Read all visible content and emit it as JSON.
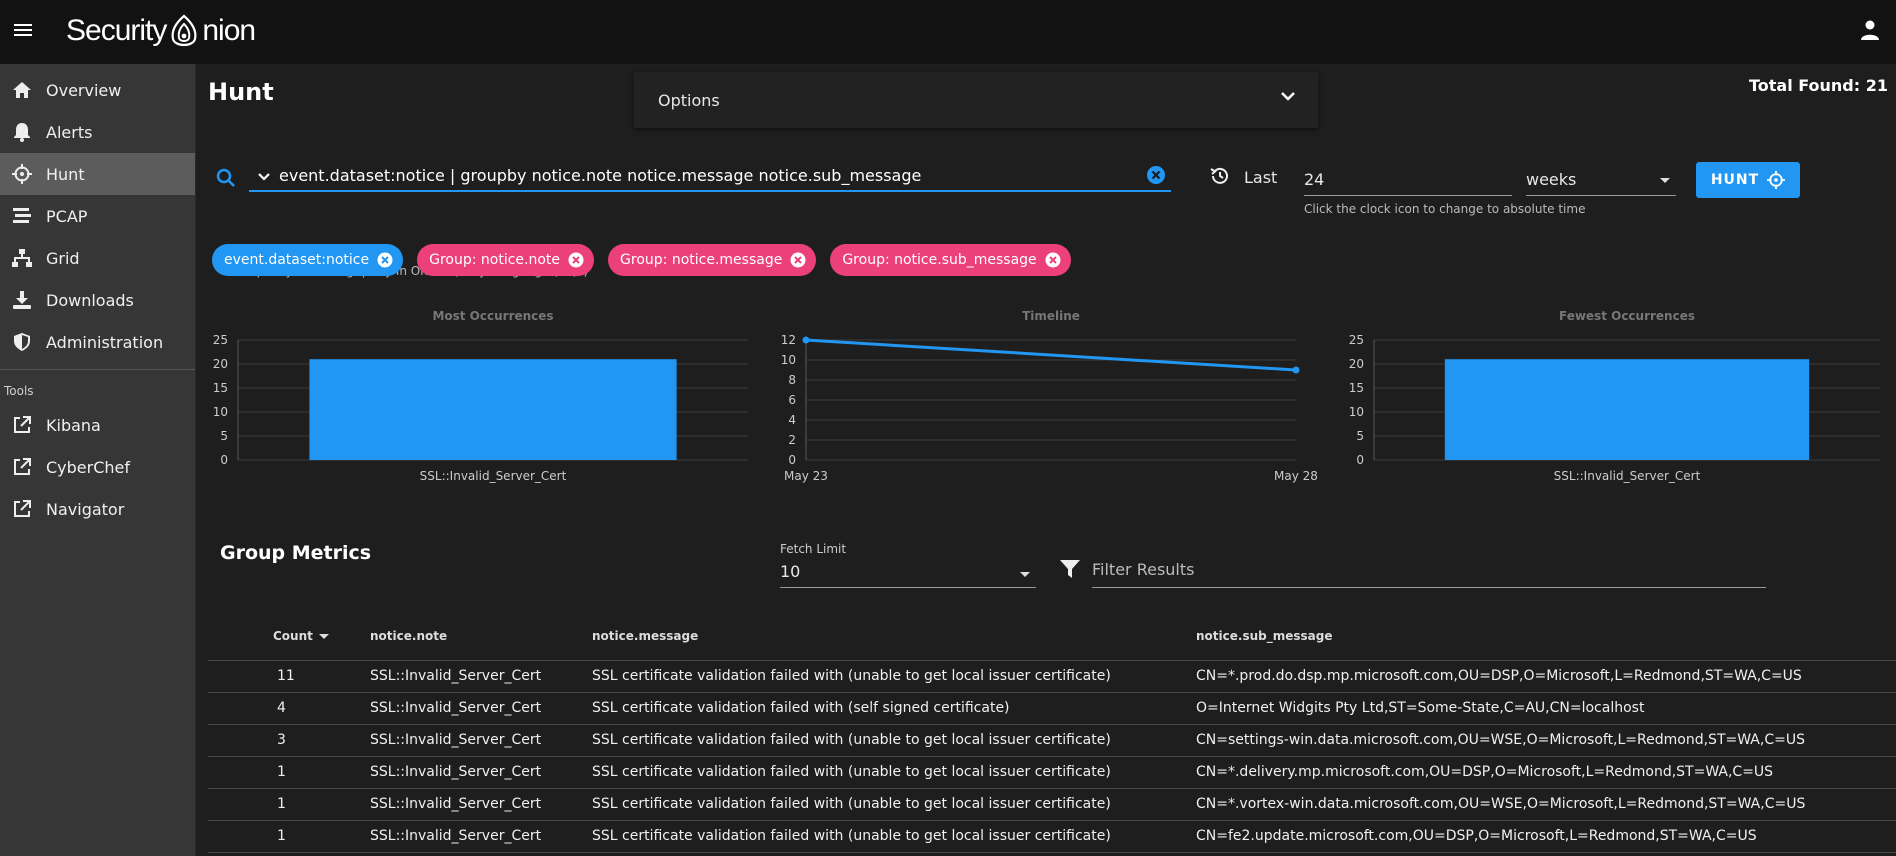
{
  "app": {
    "brand": "Security Onion"
  },
  "sidebar": {
    "items": [
      {
        "label": "Overview",
        "icon": "home-icon"
      },
      {
        "label": "Alerts",
        "icon": "bell-icon"
      },
      {
        "label": "Hunt",
        "icon": "crosshairs-icon",
        "active": true
      },
      {
        "label": "PCAP",
        "icon": "stream-icon"
      },
      {
        "label": "Grid",
        "icon": "sitemap-icon"
      },
      {
        "label": "Downloads",
        "icon": "download-icon"
      },
      {
        "label": "Administration",
        "icon": "shield-icon"
      }
    ],
    "tools_label": "Tools",
    "tools": [
      {
        "label": "Kibana",
        "icon": "external-link-icon"
      },
      {
        "label": "CyberChef",
        "icon": "external-link-icon"
      },
      {
        "label": "Navigator",
        "icon": "external-link-icon"
      }
    ]
  },
  "header": {
    "title": "Hunt",
    "options_label": "Options",
    "total_found": "Total Found: 21"
  },
  "query": {
    "value": "event.dataset:notice | groupby notice.note notice.message notice.sub_message",
    "hint": "Specify a hunting query in Onion Query Language (OQL)"
  },
  "time": {
    "last_label": "Last",
    "value": "24",
    "units": "weeks",
    "hint": "Click the clock icon to change to absolute time",
    "hunt_label": "HUNT"
  },
  "chips": [
    {
      "label": "event.dataset:notice",
      "color": "#2196f3"
    },
    {
      "label": "Group: notice.note",
      "color": "#ec407a"
    },
    {
      "label": "Group: notice.message",
      "color": "#ec407a"
    },
    {
      "label": "Group: notice.sub_message",
      "color": "#ec407a"
    }
  ],
  "chart_data": [
    {
      "type": "bar",
      "title": "Most Occurrences",
      "categories": [
        "SSL::Invalid_Server_Cert"
      ],
      "values": [
        21
      ],
      "ylim": [
        0,
        25
      ],
      "yticks": [
        0,
        5,
        10,
        15,
        20,
        25
      ],
      "grid": true,
      "color": "#2196f3"
    },
    {
      "type": "line",
      "title": "Timeline",
      "x": [
        "May 23",
        "May 28"
      ],
      "values": [
        12,
        9
      ],
      "ylim": [
        0,
        12
      ],
      "yticks": [
        0,
        2,
        4,
        6,
        8,
        10,
        12
      ],
      "grid": true,
      "color": "#2196f3"
    },
    {
      "type": "bar",
      "title": "Fewest Occurrences",
      "categories": [
        "SSL::Invalid_Server_Cert"
      ],
      "values": [
        21
      ],
      "ylim": [
        0,
        25
      ],
      "yticks": [
        0,
        5,
        10,
        15,
        20,
        25
      ],
      "grid": true,
      "color": "#2196f3"
    }
  ],
  "group_metrics": {
    "title": "Group Metrics",
    "fetch_limit_label": "Fetch Limit",
    "fetch_limit": "10",
    "filter_placeholder": "Filter Results",
    "columns": [
      "Count",
      "notice.note",
      "notice.message",
      "notice.sub_message"
    ],
    "rows": [
      [
        "11",
        "SSL::Invalid_Server_Cert",
        "SSL certificate validation failed with (unable to get local issuer certificate)",
        "CN=*.prod.do.dsp.mp.microsoft.com,OU=DSP,O=Microsoft,L=Redmond,ST=WA,C=US"
      ],
      [
        "4",
        "SSL::Invalid_Server_Cert",
        "SSL certificate validation failed with (self signed certificate)",
        "O=Internet Widgits Pty Ltd,ST=Some-State,C=AU,CN=localhost"
      ],
      [
        "3",
        "SSL::Invalid_Server_Cert",
        "SSL certificate validation failed with (unable to get local issuer certificate)",
        "CN=settings-win.data.microsoft.com,OU=WSE,O=Microsoft,L=Redmond,ST=WA,C=US"
      ],
      [
        "1",
        "SSL::Invalid_Server_Cert",
        "SSL certificate validation failed with (unable to get local issuer certificate)",
        "CN=*.delivery.mp.microsoft.com,OU=DSP,O=Microsoft,L=Redmond,ST=WA,C=US"
      ],
      [
        "1",
        "SSL::Invalid_Server_Cert",
        "SSL certificate validation failed with (unable to get local issuer certificate)",
        "CN=*.vortex-win.data.microsoft.com,OU=WSE,O=Microsoft,L=Redmond,ST=WA,C=US"
      ],
      [
        "1",
        "SSL::Invalid_Server_Cert",
        "SSL certificate validation failed with (unable to get local issuer certificate)",
        "CN=fe2.update.microsoft.com,OU=DSP,O=Microsoft,L=Redmond,ST=WA,C=US"
      ]
    ]
  }
}
